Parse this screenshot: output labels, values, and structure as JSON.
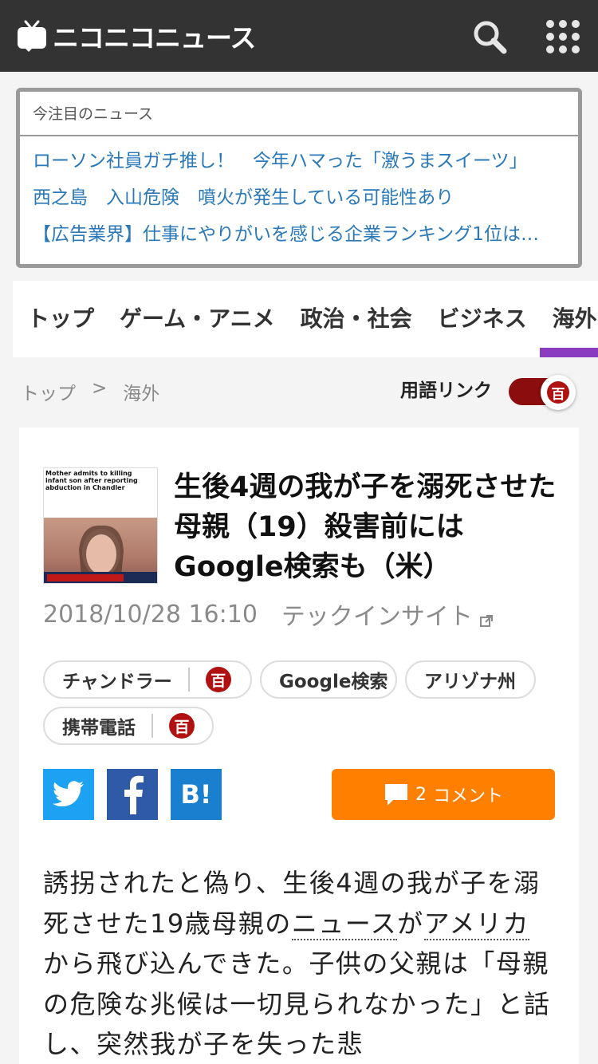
{
  "header": {
    "logo_text": "ニコニコニュース",
    "search_icon": "search-icon",
    "menu_icon": "grid-menu-icon"
  },
  "trending": {
    "title": "今注目のニュース",
    "items": [
      "ローソン社員ガチ推し！　今年ハマった「激うまスイーツ」",
      "西之島　入山危険　噴火が発生している可能性あり",
      "【広告業界】仕事にやりがいを感じる企業ランキング1位は…"
    ]
  },
  "categories": {
    "items": [
      "トップ",
      "ゲーム・アニメ",
      "政治・社会",
      "ビジネス",
      "海外"
    ],
    "active": "海外",
    "active_color": "#8a3cc0"
  },
  "breadcrumb": {
    "home": "トップ",
    "separator": ">",
    "current": "海外"
  },
  "term_link": {
    "label": "用語リンク",
    "badge": "百",
    "enabled": true,
    "color": "#8b0d0d"
  },
  "article": {
    "thumb_caption": "Mother admits to killing infant son after reporting abduction in Chandler",
    "headline": "生後4週の我が子を溺死させた母親（19）殺害前にはGoogle検索も（米）",
    "datetime": "2018/10/28 16:10",
    "source": "テックインサイト",
    "tags": [
      {
        "label": "チャンドラー",
        "badge": "百"
      },
      {
        "label": "Google検索",
        "badge": ""
      },
      {
        "label": "アリゾナ州",
        "badge": ""
      },
      {
        "label": "携帯電話",
        "badge": "百"
      }
    ],
    "share": {
      "twitter_icon": "twitter-icon",
      "facebook_icon": "facebook-icon",
      "hatena_label": "B!"
    },
    "comments": {
      "count": "2",
      "label": "コメント",
      "color": "#ff8000"
    },
    "body_parts": {
      "p1": "誘拐されたと偽り、生後4週の我が子を溺死させた19歳母親の",
      "kw1": "ニュース",
      "p2": "が",
      "kw2": "アメリカ",
      "p3": "から飛び込んできた。子供の父親は「母親の危険な兆候は一切見られなかった」と話し、突然我が子を失った悲"
    }
  }
}
